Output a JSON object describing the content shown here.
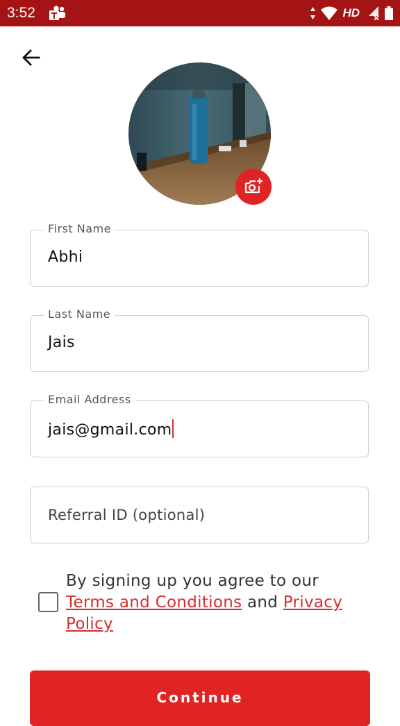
{
  "status_bar": {
    "time": "3:52",
    "network": "HD",
    "icons": [
      "teams-icon",
      "data-arrows-icon",
      "wifi-icon",
      "signal-icon",
      "battery-icon"
    ]
  },
  "header": {
    "back_icon": "arrow-left-icon"
  },
  "profile": {
    "photo_icon": "camera-add-icon",
    "accent": "#e02424"
  },
  "form": {
    "first_name": {
      "label": "First Name",
      "value": "Abhi"
    },
    "last_name": {
      "label": "Last Name",
      "value": "Jais"
    },
    "email": {
      "label": "Email Address",
      "value": "jais@gmail.com"
    },
    "referral": {
      "placeholder": "Referral ID (optional)"
    }
  },
  "agreement": {
    "checked": false,
    "text_before": "By signing up you agree to our ",
    "terms_link": "Terms and Conditions",
    "text_between": " and ",
    "privacy_link": "Privacy Policy"
  },
  "continue_label": "Continue",
  "colors": {
    "status_bar": "#a41414",
    "primary": "#e02424",
    "link": "#d32f2f"
  }
}
